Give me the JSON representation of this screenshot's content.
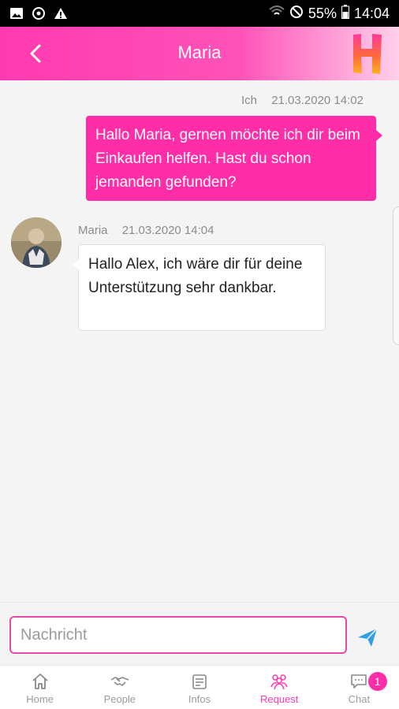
{
  "status": {
    "battery": "55%",
    "time": "14:04"
  },
  "header": {
    "title": "Maria"
  },
  "messages": [
    {
      "sender": "Ich",
      "timestamp": "21.03.2020 14:02",
      "text": "Hallo Maria, gernen möchte ich dir beim Einkaufen helfen. Hast du schon jemanden gefunden?"
    },
    {
      "sender": "Maria",
      "timestamp": "21.03.2020 14:04",
      "text": "Hallo Alex, ich wäre dir für deine Unterstützung sehr dankbar."
    }
  ],
  "input": {
    "placeholder": "Nachricht",
    "value": ""
  },
  "nav": {
    "items": [
      {
        "label": "Home",
        "icon": "home-icon"
      },
      {
        "label": "People",
        "icon": "handshake-icon"
      },
      {
        "label": "Infos",
        "icon": "news-icon"
      },
      {
        "label": "Request",
        "icon": "group-icon",
        "active": true
      },
      {
        "label": "Chat",
        "icon": "chat-icon",
        "badge": "1"
      }
    ]
  },
  "colors": {
    "accent": "#ff2ea8",
    "header_gradient_end": "#ffd0ea"
  }
}
